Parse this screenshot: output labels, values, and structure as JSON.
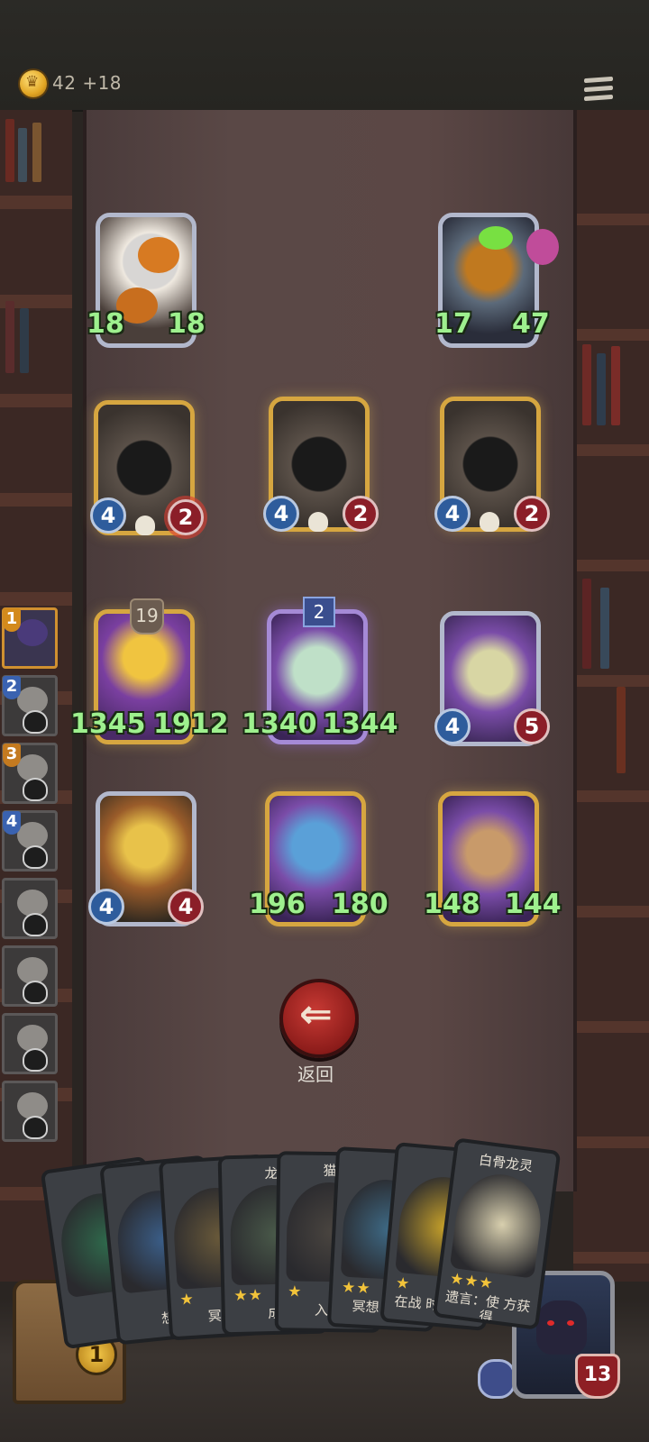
{
  "header": {
    "gold": "42",
    "income": "+18"
  },
  "board": {
    "top_row": [
      {
        "name": "pumpkin-minion",
        "attack": "18",
        "health": "18",
        "frame": "silver"
      },
      {
        "name": "pumpkin-boss",
        "attack": "17",
        "health": "47",
        "frame": "silver"
      }
    ],
    "reaper_row": [
      {
        "name": "reaper-1",
        "attack": "4",
        "health": "2"
      },
      {
        "name": "reaper-2",
        "attack": "4",
        "health": "2"
      },
      {
        "name": "reaper-3",
        "attack": "4",
        "health": "2"
      }
    ],
    "mid_row": [
      {
        "name": "blonde-mage",
        "attack": "1345",
        "health": "1912",
        "level": "19"
      },
      {
        "name": "unicorn-spirit",
        "attack": "1340",
        "health": "1344",
        "tier": "2"
      },
      {
        "name": "hooded-bear",
        "attack": "4",
        "health": "5"
      }
    ],
    "bottom_row": [
      {
        "name": "golden-knight",
        "attack": "4",
        "health": "4"
      },
      {
        "name": "blue-haired-elf",
        "attack": "196",
        "health": "180"
      },
      {
        "name": "dwarf-king",
        "attack": "148",
        "health": "144"
      }
    ]
  },
  "queue": [
    {
      "num": "1",
      "active": true
    },
    {
      "num": "2",
      "active": false
    },
    {
      "num": "3",
      "active": false
    },
    {
      "num": "4",
      "active": false
    },
    {
      "num": "",
      "active": false
    },
    {
      "num": "",
      "active": false
    },
    {
      "num": "",
      "active": false
    },
    {
      "num": "",
      "active": false
    }
  ],
  "back_button": {
    "label": "返回"
  },
  "hand": [
    {
      "name": "",
      "stars": "",
      "desc": ""
    },
    {
      "name": "",
      "stars": "",
      "desc": "想"
    },
    {
      "name": "",
      "stars": "★",
      "desc": "冥想"
    },
    {
      "name": "龙",
      "stars": "★★",
      "desc": "成"
    },
    {
      "name": "猫",
      "stars": "★",
      "desc": "入场"
    },
    {
      "name": "",
      "stars": "★★",
      "desc": "冥想 其他"
    },
    {
      "name": "",
      "stars": "★",
      "desc": "在战 时, 方若"
    },
    {
      "name": "白骨龙灵",
      "stars": "★★★",
      "desc": "遗言：使 方获得"
    }
  ],
  "chest": {
    "count": "1"
  },
  "hero": {
    "health": "13"
  }
}
